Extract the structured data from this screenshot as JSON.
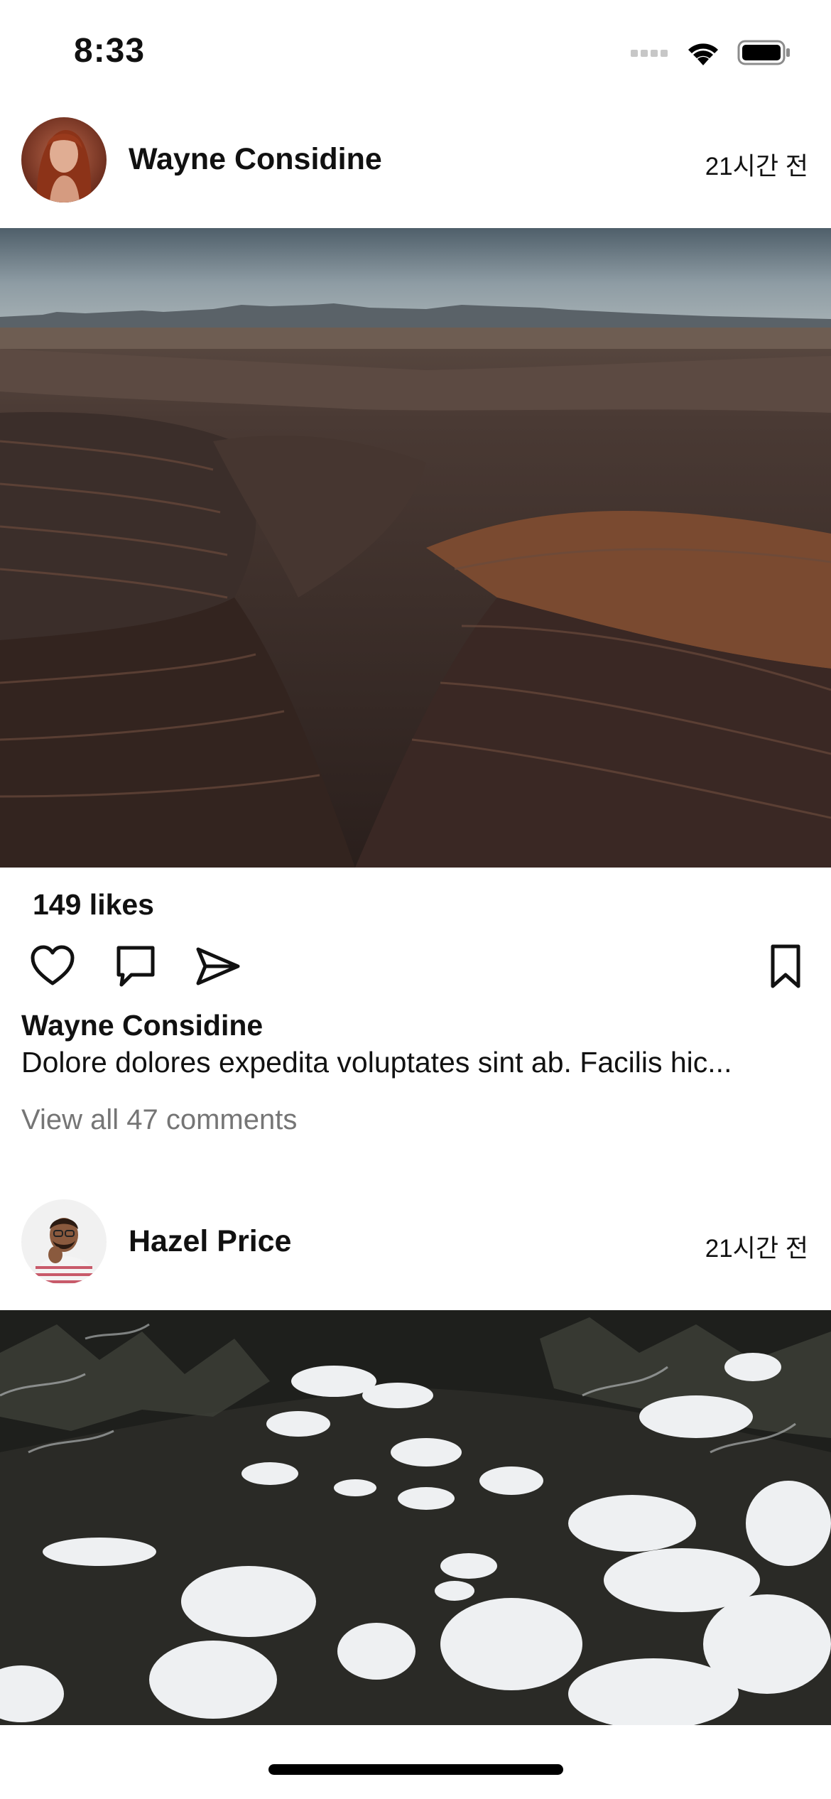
{
  "status_bar": {
    "time": "8:33",
    "icons": [
      "cellular-icon",
      "wifi-icon",
      "battery-icon"
    ]
  },
  "posts": [
    {
      "username": "Wayne Considine",
      "timestamp": "21시간 전",
      "avatar": "avatar-woman-red-hair",
      "image": "canyon-landscape",
      "likes": "149 likes",
      "actions": [
        "heart-icon",
        "comment-icon",
        "send-icon",
        "bookmark-icon"
      ],
      "caption_user": "Wayne Considine",
      "caption": "Dolore dolores expedita voluptates sint ab. Facilis hic...",
      "view_comments": "View all 47 comments"
    },
    {
      "username": "Hazel Price",
      "timestamp": "21시간 전",
      "avatar": "avatar-man-striped-shirt",
      "image": "snowy-creek"
    }
  ],
  "colors": {
    "background": "#ffffff",
    "text": "#111111",
    "muted": "#757575"
  }
}
